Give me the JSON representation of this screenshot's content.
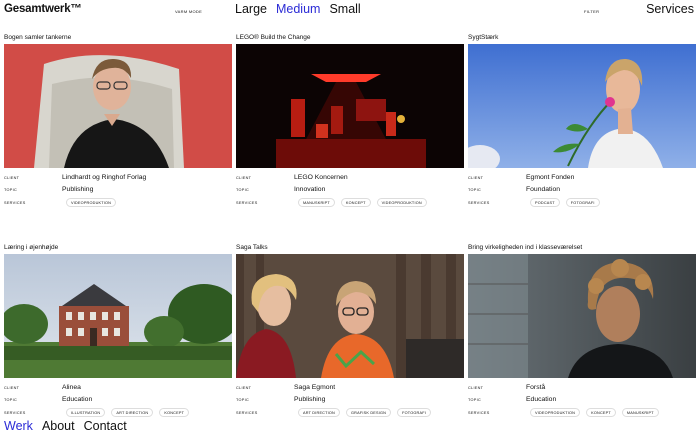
{
  "header": {
    "logo": "Gesamtwerk™",
    "view_mode": "VARM MODE",
    "sizes": [
      "Large",
      "Medium",
      "Small"
    ],
    "filter": "FILTER",
    "services": "Services"
  },
  "labels": {
    "client": "CLIENT",
    "topic": "TOPIC",
    "services": "SERVICES"
  },
  "projects": [
    {
      "title": "Bogen samler tankerne",
      "client": "Lindhardt og Ringhof Forlag",
      "topic": "Publishing",
      "services": [
        "VIDEOPRODUKTION"
      ]
    },
    {
      "title": "LEGO® Build the Change",
      "client": "LEGO Koncernen",
      "topic": "Innovation",
      "services": [
        "MANUSKRIPT",
        "KONCEPT",
        "VIDEOPRODUKTION"
      ]
    },
    {
      "title": "SygtStærk",
      "client": "Egmont Fonden",
      "topic": "Foundation",
      "services": [
        "PODCAST",
        "FOTOGRAFI"
      ]
    },
    {
      "title": "Læring i øjenhøjde",
      "client": "Alinea",
      "topic": "Education",
      "services": [
        "ILLUSTRATION",
        "ART DIRECTION",
        "KONCEPT"
      ]
    },
    {
      "title": "Saga Talks",
      "client": "Saga Egmont",
      "topic": "Publishing",
      "services": [
        "ART DIRECTION",
        "GRAFISK DESIGN",
        "FOTOGRAFI"
      ]
    },
    {
      "title": "Bring virkeligheden ind i klasseværelset",
      "client": "Forstå",
      "topic": "Education",
      "services": [
        "VIDEOPRODUKTION",
        "KONCEPT",
        "MANUSKRIPT"
      ]
    }
  ],
  "footer": {
    "links": [
      "Werk",
      "About",
      "Contact"
    ]
  }
}
